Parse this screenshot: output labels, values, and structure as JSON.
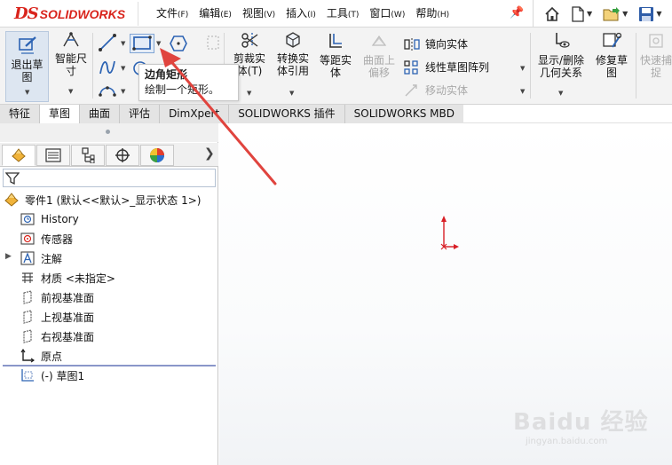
{
  "app": {
    "logo_ds": "DS",
    "logo_name": "SOLIDWORKS"
  },
  "menu": [
    {
      "label": "文件",
      "key": "(F)"
    },
    {
      "label": "编辑",
      "key": "(E)"
    },
    {
      "label": "视图",
      "key": "(V)"
    },
    {
      "label": "插入",
      "key": "(I)"
    },
    {
      "label": "工具",
      "key": "(T)"
    },
    {
      "label": "窗口",
      "key": "(W)"
    },
    {
      "label": "帮助",
      "key": "(H)"
    }
  ],
  "quick_access": [
    "home-icon",
    "new-document-icon",
    "open-folder-icon",
    "save-icon"
  ],
  "ribbon": {
    "exit_sketch": "退出草\n图",
    "smart_dimension": "智能尺\n寸",
    "trim": "剪裁实\n体(T)",
    "convert": "转换实\n体引用",
    "offset": "等距实\n体",
    "surface_offset": "曲面上\n偏移",
    "mirror": "镜向实体",
    "linear_pattern": "线性草图阵列",
    "move": "移动实体",
    "display_relations": "显示/删除\n几何关系",
    "repair": "修复草\n图",
    "quick_snap": "快速捕\n捉"
  },
  "tooltip": {
    "title": "边角矩形",
    "desc": "绘制一个矩形。"
  },
  "tabs": [
    {
      "label": "特征",
      "active": false
    },
    {
      "label": "草图",
      "active": true
    },
    {
      "label": "曲面",
      "active": false
    },
    {
      "label": "评估",
      "active": false
    },
    {
      "label": "DimXpert",
      "active": false
    },
    {
      "label": "SOLIDWORKS 插件",
      "active": false
    },
    {
      "label": "SOLIDWORKS MBD",
      "active": false
    }
  ],
  "tree": {
    "root": "零件1 (默认<<默认>_显示状态 1>)",
    "items": [
      {
        "label": "History",
        "icon": "history-icon"
      },
      {
        "label": "传感器",
        "icon": "sensor-icon"
      },
      {
        "label": "注解",
        "icon": "annotation-icon"
      },
      {
        "label": "材质 <未指定>",
        "icon": "material-icon"
      },
      {
        "label": "前视基准面",
        "icon": "plane-icon"
      },
      {
        "label": "上视基准面",
        "icon": "plane-icon"
      },
      {
        "label": "右视基准面",
        "icon": "plane-icon"
      },
      {
        "label": "原点",
        "icon": "origin-icon"
      },
      {
        "label": "(-) 草图1",
        "icon": "sketch-icon"
      }
    ]
  },
  "watermark": {
    "brand": "Baidu 经验",
    "sub": "jingyan.baidu.com"
  },
  "colors": {
    "accent_red": "#d9241c",
    "origin_red": "#d81f26",
    "arrow_red": "#e0443e"
  }
}
